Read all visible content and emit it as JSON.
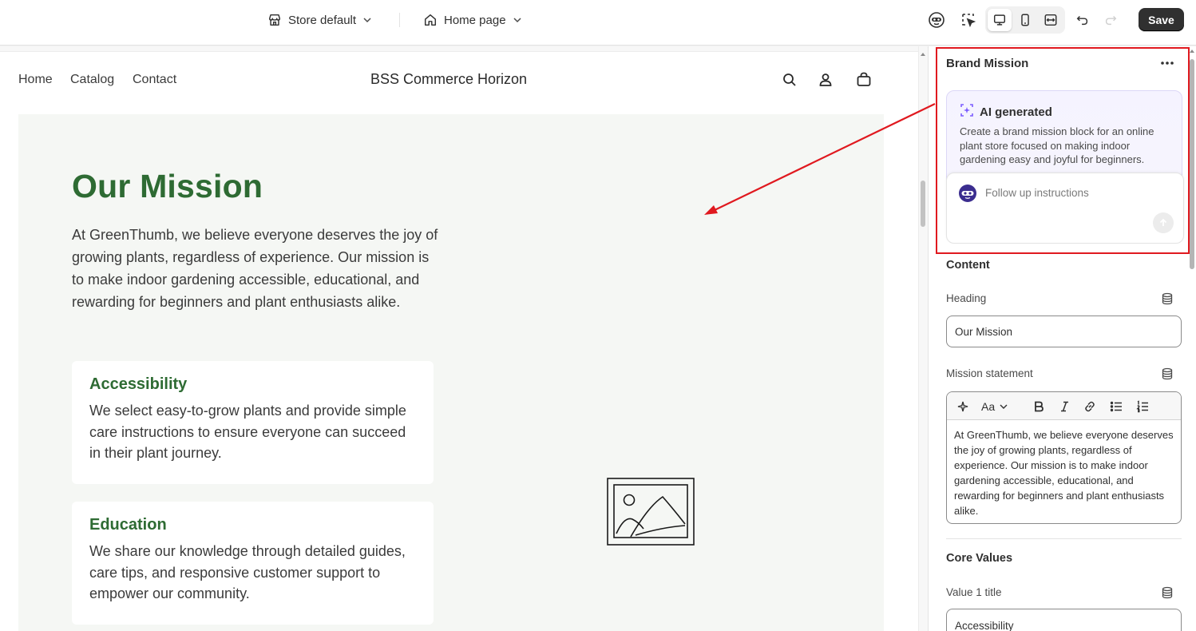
{
  "toolbar": {
    "store_select": "Store default",
    "page_select": "Home page",
    "save_label": "Save",
    "icons": [
      "ai-sidekick-icon",
      "inspector-icon",
      "desktop-icon",
      "mobile-icon",
      "fullwidth-icon",
      "undo-icon",
      "redo-icon"
    ]
  },
  "storefront": {
    "nav": [
      "Home",
      "Catalog",
      "Contact"
    ],
    "store_name": "BSS Commerce Horizon",
    "header_icons": [
      "search-icon",
      "account-icon",
      "cart-icon"
    ]
  },
  "mission": {
    "heading": "Our Mission",
    "text": "At GreenThumb, we believe everyone deserves the joy of growing plants, regardless of experience. Our mission is to make indoor gardening accessible, educational, and rewarding for beginners and plant enthusiasts alike.",
    "values": [
      {
        "title": "Accessibility",
        "text": "We select easy-to-grow plants and provide simple care instructions to ensure everyone can succeed in their plant journey."
      },
      {
        "title": "Education",
        "text": "We share our knowledge through detailed guides, care tips, and responsive customer support to empower our community."
      }
    ]
  },
  "panel": {
    "title": "Brand Mission",
    "ai": {
      "label": "AI generated",
      "prompt": "Create a brand mission block for an online plant store focused on making indoor gardening easy and joyful for beginners.",
      "followup_placeholder": "Follow up instructions"
    },
    "content_label": "Content",
    "heading_label": "Heading",
    "heading_value": "Our Mission",
    "statement_label": "Mission statement",
    "statement_value": "At GreenThumb, we believe everyone deserves the joy of growing plants, regardless of experience. Our mission is to make indoor gardening accessible, educational, and rewarding for beginners and plant enthusiasts alike.",
    "core_values_label": "Core Values",
    "value1_title_label": "Value 1 title",
    "value1_title_value": "Accessibility"
  },
  "colors": {
    "accent_green": "#2e6b33",
    "annotation_red": "#e0191f",
    "save_button": "#303030",
    "ai_purple": "#7c5cff"
  }
}
